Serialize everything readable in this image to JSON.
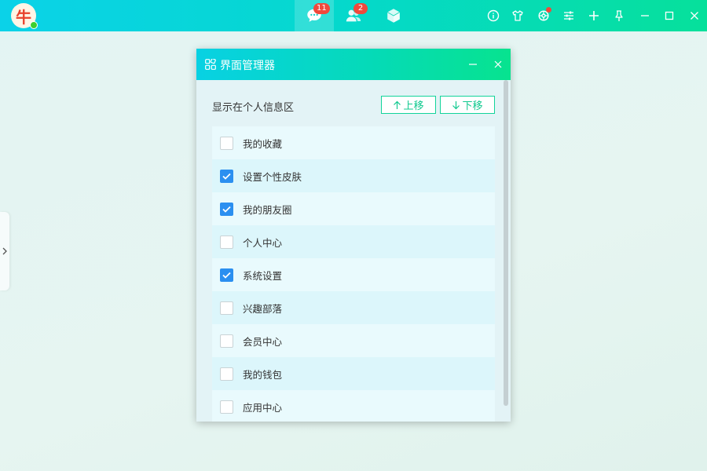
{
  "topbar": {
    "logo_glyph": "牛",
    "tabs": [
      {
        "name": "messages",
        "icon": "chat-bubble-icon",
        "badge": "11",
        "active": true
      },
      {
        "name": "contacts",
        "icon": "contacts-icon",
        "badge": "2",
        "active": false
      },
      {
        "name": "apps",
        "icon": "cube-icon",
        "badge": "",
        "active": false
      }
    ],
    "tools": [
      "info-icon",
      "skin-shirt-icon",
      "settings-gear-icon",
      "sliders-icon",
      "plus-icon",
      "pin-icon",
      "minimize-icon",
      "maximize-icon",
      "close-icon"
    ]
  },
  "dialog": {
    "title": "界面管理器",
    "section_label": "显示在个人信息区",
    "move_up_label": "上移",
    "move_down_label": "下移",
    "items": [
      {
        "label": "我的收藏",
        "checked": false
      },
      {
        "label": "设置个性皮肤",
        "checked": true
      },
      {
        "label": "我的朋友圈",
        "checked": true
      },
      {
        "label": "个人中心",
        "checked": false
      },
      {
        "label": "系统设置",
        "checked": true
      },
      {
        "label": "兴趣部落",
        "checked": false
      },
      {
        "label": "会员中心",
        "checked": false
      },
      {
        "label": "我的钱包",
        "checked": false
      },
      {
        "label": "应用中心",
        "checked": false
      }
    ]
  },
  "colors": {
    "accent_green": "#12d49a",
    "checkbox_blue": "#2b8ff0",
    "badge_red": "#f0493c"
  }
}
